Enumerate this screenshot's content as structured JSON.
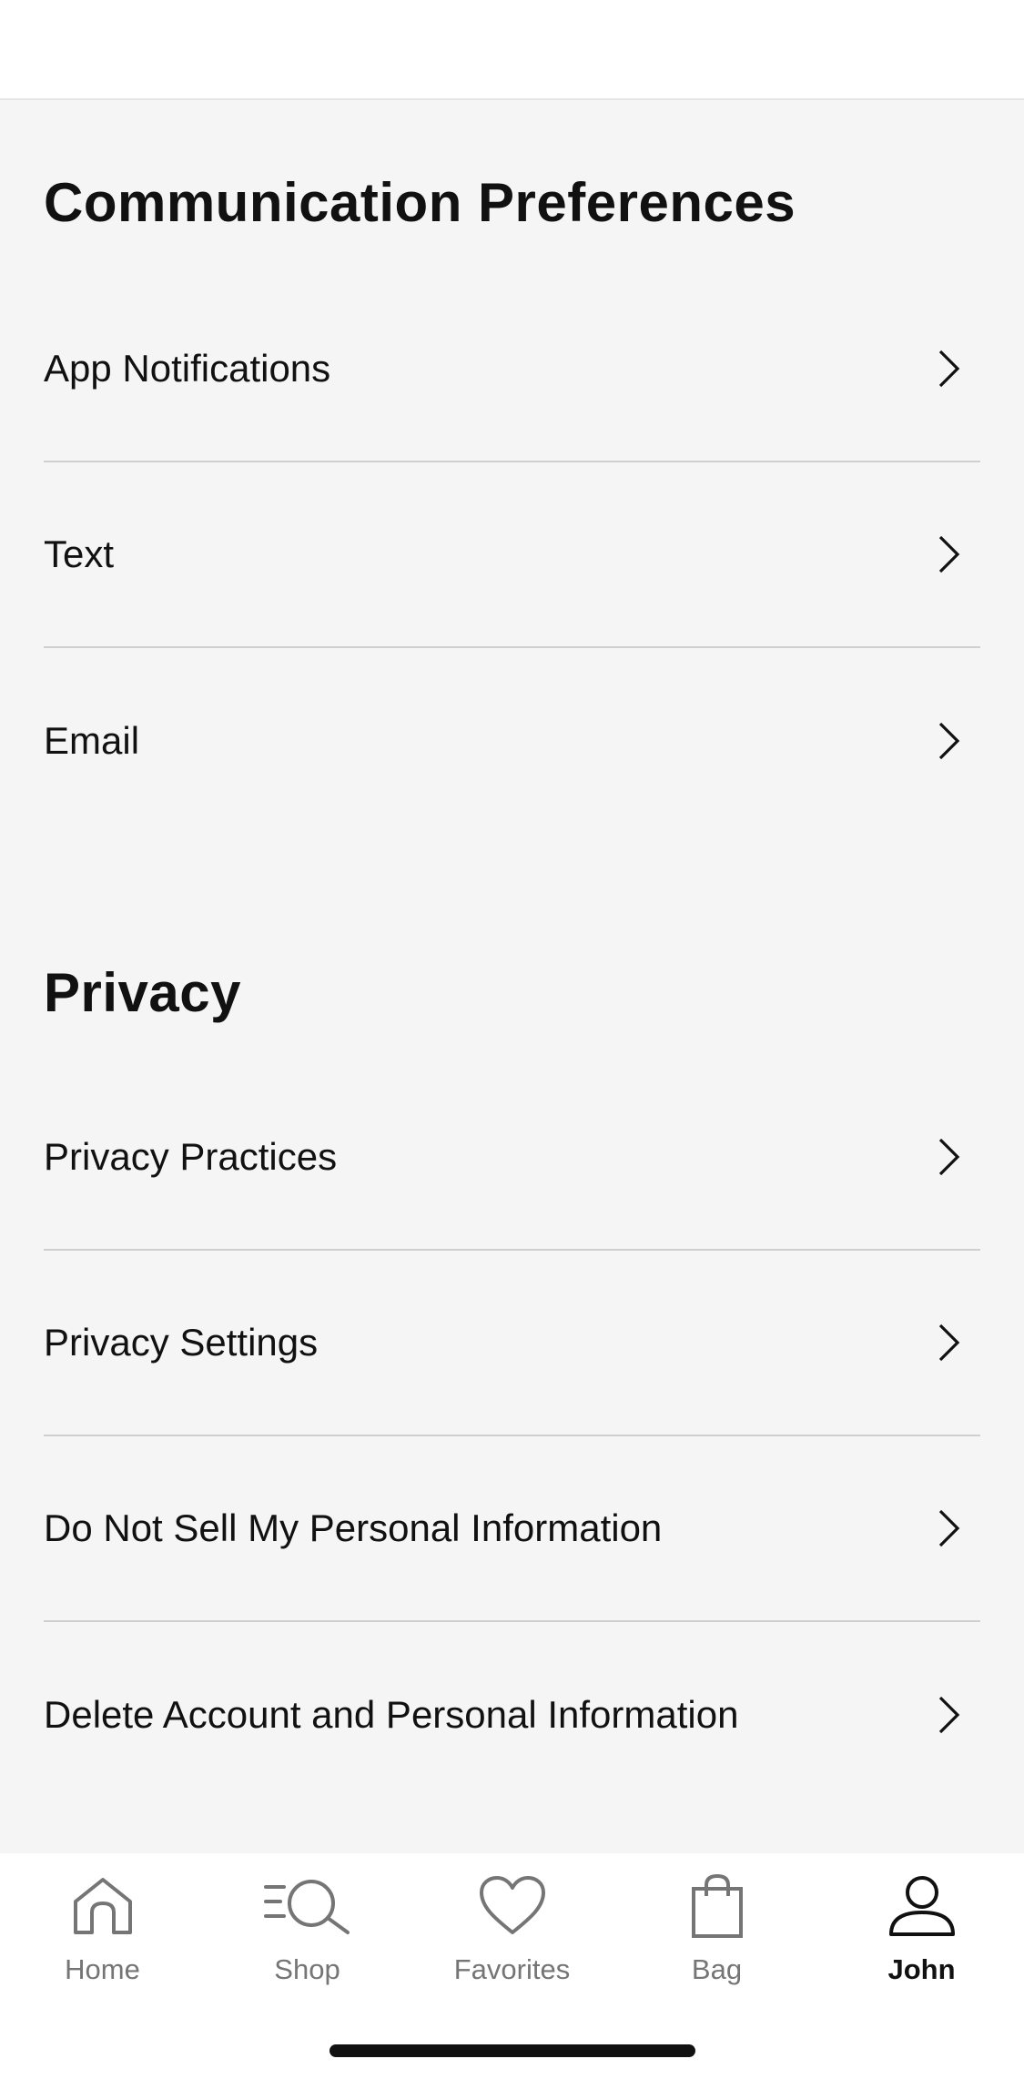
{
  "sections": {
    "communication": {
      "title": "Communication Preferences",
      "items": [
        {
          "label": "App Notifications"
        },
        {
          "label": "Text"
        },
        {
          "label": "Email"
        }
      ]
    },
    "privacy": {
      "title": "Privacy",
      "items": [
        {
          "label": "Privacy Practices"
        },
        {
          "label": "Privacy Settings"
        },
        {
          "label": "Do Not Sell My Personal Information"
        },
        {
          "label": "Delete Account and Personal Information"
        }
      ]
    }
  },
  "tabbar": {
    "items": [
      {
        "label": "Home",
        "icon": "home-icon"
      },
      {
        "label": "Shop",
        "icon": "search-icon"
      },
      {
        "label": "Favorites",
        "icon": "heart-icon"
      },
      {
        "label": "Bag",
        "icon": "bag-icon"
      },
      {
        "label": "John",
        "icon": "profile-icon",
        "active": true
      }
    ]
  },
  "colors": {
    "background": "#f5f5f5",
    "text": "#111111",
    "inactive_tab": "#757575",
    "divider": "#cfcfcf"
  }
}
